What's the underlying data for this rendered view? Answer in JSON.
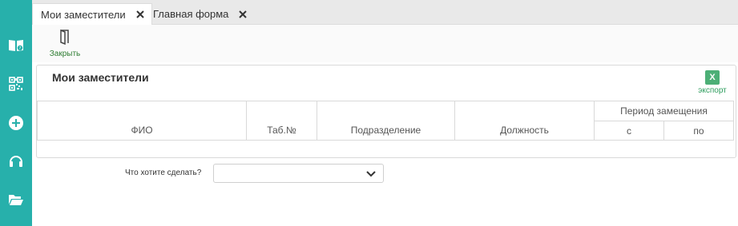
{
  "sidebar": {
    "icons": [
      "book-help-icon",
      "qr-code-icon",
      "add-circle-icon",
      "headset-icon",
      "folder-open-icon"
    ]
  },
  "tabs": [
    {
      "label": "Мои заместители",
      "active": true
    },
    {
      "label": "Главная форма",
      "active": false
    }
  ],
  "toolbar": {
    "close_label": "Закрыть"
  },
  "panel": {
    "title": "Мои заместители",
    "export_icon_text": "X",
    "export_label": "экспорт"
  },
  "table": {
    "columns": {
      "fio": "ФИО",
      "tab_no": "Таб.№",
      "department": "Подразделение",
      "position": "Должность",
      "period": "Период замещения",
      "from": "с",
      "to": "по"
    },
    "rows": []
  },
  "action": {
    "label": "Что хотите сделать?",
    "selected": ""
  },
  "colors": {
    "sidebar": "#27b0ab",
    "accent_green": "#2e7d32",
    "excel_green": "#4caf76"
  }
}
